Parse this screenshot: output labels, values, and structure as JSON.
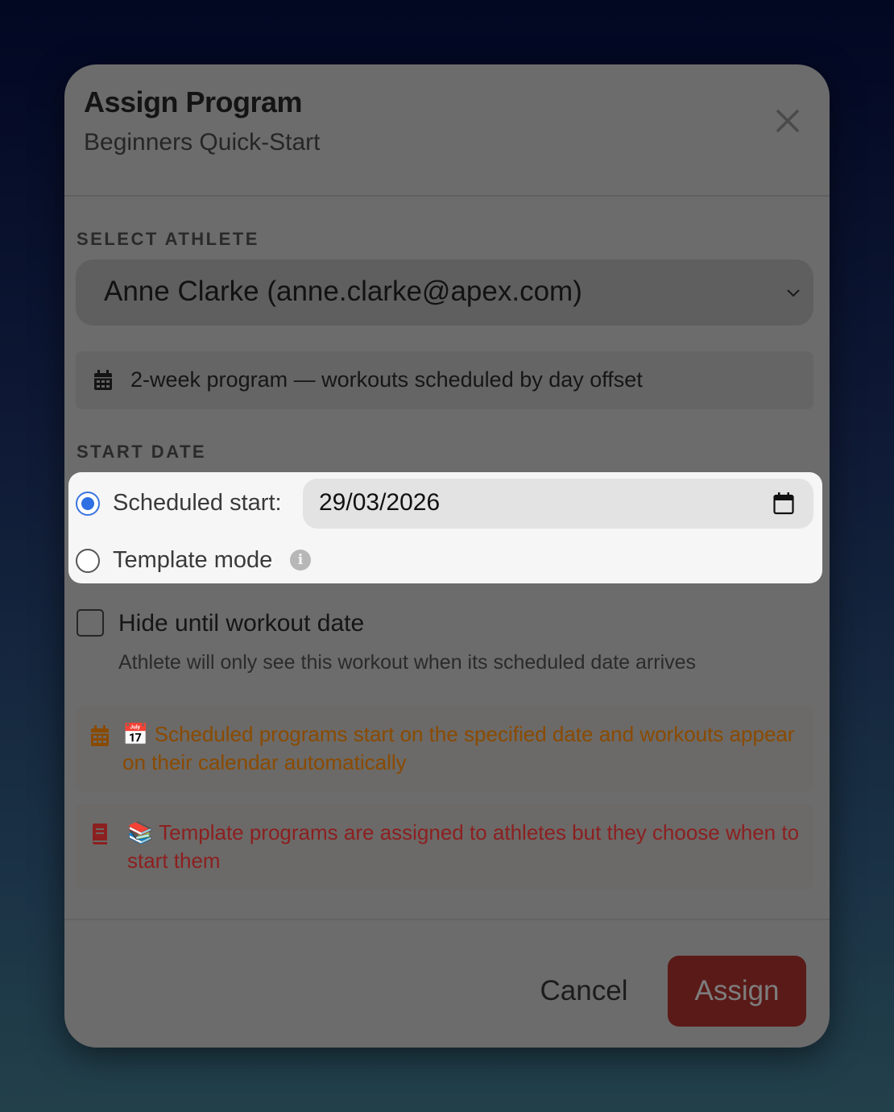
{
  "modal": {
    "title": "Assign Program",
    "subtitle": "Beginners Quick-Start",
    "close_icon": "close-icon"
  },
  "athlete": {
    "section_label": "SELECT ATHLETE",
    "selected": "Anne Clarke (anne.clarke@apex.com)",
    "chevron_icon": "chevron-down-icon"
  },
  "program_info": {
    "icon": "calendar-icon",
    "text": "2-week program — workouts scheduled by day offset"
  },
  "start_date": {
    "section_label": "START DATE",
    "scheduled_label": "Scheduled start:",
    "scheduled_selected": true,
    "date_value": "29/03/2026",
    "template_label": "Template mode",
    "template_selected": false,
    "info_icon": "info-icon"
  },
  "hide_option": {
    "checked": false,
    "label": "Hide until workout date",
    "help": "Athlete will only see this workout when its scheduled date arrives"
  },
  "notes": {
    "scheduled": {
      "icon": "calendar-icon",
      "text": "📅 Scheduled programs start on the specified date and workouts appear on their calendar automatically",
      "color": "#8a4a00"
    },
    "template": {
      "icon": "book-icon",
      "text": "📚 Template programs are assigned to athletes but they choose when to start them",
      "color": "#8c1f1f"
    }
  },
  "footer": {
    "cancel_label": "Cancel",
    "assign_label": "Assign"
  },
  "colors": {
    "accent": "#2f6fe4",
    "assign_button": "#5a1a17"
  }
}
